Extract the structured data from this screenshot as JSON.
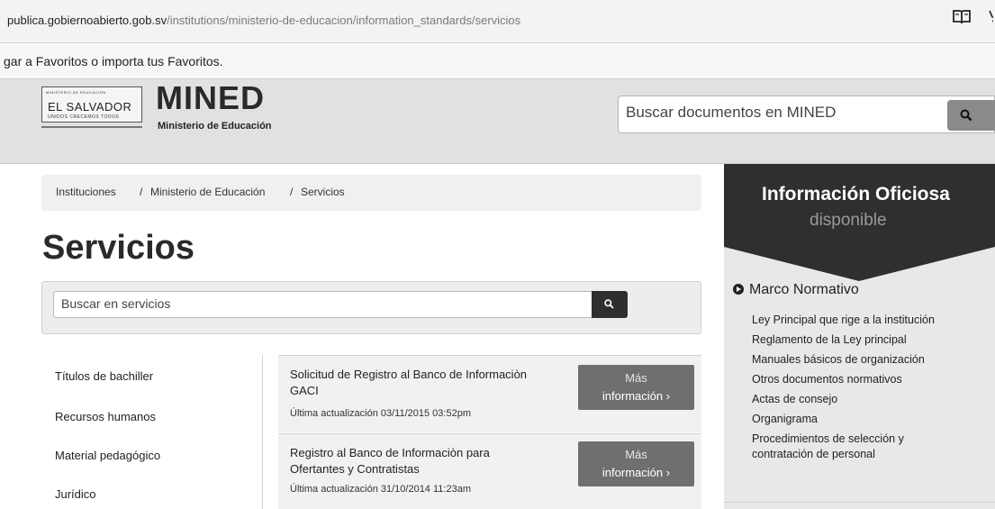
{
  "browser": {
    "url_host": "publica.gobiernoabierto.gob.sv",
    "url_path": "/institutions/ministerio-de-educacion/information_standards/servicios",
    "favorites_text": "gar a Favoritos o importa tus Favoritos."
  },
  "header": {
    "logo_country": "EL SALVADOR",
    "logo_small": "MINISTERIO DE EDUCACIÓN",
    "logo_motto": "UNIDOS CRECEMOS TODOS",
    "brand": "MINED",
    "brand_sub": "Ministerio de Educación",
    "search_placeholder": "Buscar documentos en MINED"
  },
  "breadcrumb": {
    "items": [
      "Instituciones",
      "Ministerio de Educación",
      "Servicios"
    ],
    "sep": "/"
  },
  "page": {
    "title": "Servicios",
    "search_placeholder": "Buscar en servicios"
  },
  "categories": [
    "Títulos de bachiller",
    "Recursos humanos",
    "Material pedagógico",
    "Jurídico"
  ],
  "services": [
    {
      "name_l1": "Solicitud de Registro al Banco de Informaciòn",
      "name_l2": "GACI",
      "date": "Última actualización 03/11/2015 03:52pm",
      "more_l1": "Más",
      "more_l2": "información ›"
    },
    {
      "name_l1": "Registro al Banco de Informaciòn para",
      "name_l2": "Ofertantes y Contratistas",
      "date": "Última actualización 31/10/2014 11:23am",
      "more_l1": "Más",
      "more_l2": "información ›"
    }
  ],
  "right_panel": {
    "title": "Información Oficiosa",
    "subtitle": "disponible",
    "section": "Marco Normativo",
    "links": [
      "Ley Principal que rige a la institución",
      "Reglamento de la Ley principal",
      "Manuales básicos de organización",
      "Otros documentos normativos",
      "Actas de consejo",
      "Organigrama",
      "Procedimientos de selección y",
      "contratación de personal"
    ]
  },
  "icons": [
    "reading-view-icon",
    "favorite-star-icon",
    "search-icon",
    "section-bullet-icon"
  ]
}
